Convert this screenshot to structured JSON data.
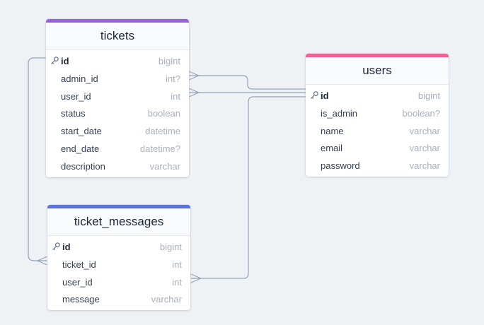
{
  "colors": {
    "tickets_accent": "#9b5de5",
    "users_accent": "#f0628f",
    "ticket_messages_accent": "#5b72d6",
    "connector": "#94a3b8",
    "background": "#eef2f5"
  },
  "tables": {
    "tickets": {
      "name": "tickets",
      "fields": [
        {
          "name": "id",
          "type": "bigint",
          "pk": true
        },
        {
          "name": "admin_id",
          "type": "int?"
        },
        {
          "name": "user_id",
          "type": "int"
        },
        {
          "name": "status",
          "type": "boolean"
        },
        {
          "name": "start_date",
          "type": "datetime"
        },
        {
          "name": "end_date",
          "type": "datetime?"
        },
        {
          "name": "description",
          "type": "varchar"
        }
      ]
    },
    "users": {
      "name": "users",
      "fields": [
        {
          "name": "id",
          "type": "bigint",
          "pk": true
        },
        {
          "name": "is_admin",
          "type": "boolean?"
        },
        {
          "name": "name",
          "type": "varchar"
        },
        {
          "name": "email",
          "type": "varchar"
        },
        {
          "name": "password",
          "type": "varchar"
        }
      ]
    },
    "ticket_messages": {
      "name": "ticket_messages",
      "fields": [
        {
          "name": "id",
          "type": "bigint",
          "pk": true
        },
        {
          "name": "ticket_id",
          "type": "int"
        },
        {
          "name": "user_id",
          "type": "int"
        },
        {
          "name": "message",
          "type": "varchar"
        }
      ]
    }
  },
  "relations": [
    {
      "from": "tickets.admin_id",
      "to": "users.id",
      "cardinality": "many-to-one"
    },
    {
      "from": "tickets.user_id",
      "to": "users.id",
      "cardinality": "many-to-one"
    },
    {
      "from": "ticket_messages.ticket_id",
      "to": "tickets.id",
      "cardinality": "many-to-one"
    },
    {
      "from": "ticket_messages.user_id",
      "to": "users.id",
      "cardinality": "many-to-one"
    }
  ]
}
